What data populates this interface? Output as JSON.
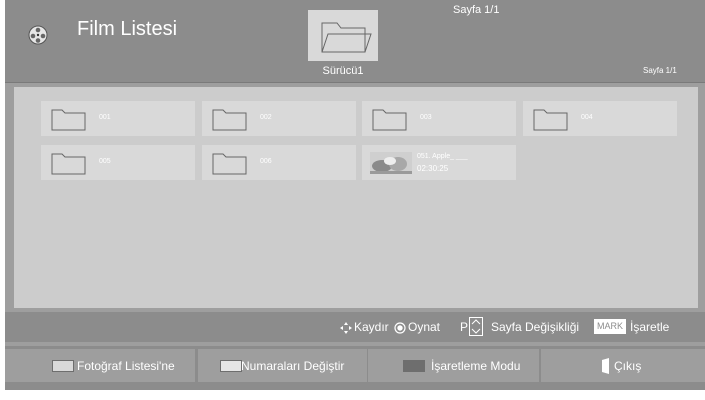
{
  "header": {
    "title": "Film Listesi",
    "drive_label": "Sürücü1",
    "page_top": "Sayfa 1/1",
    "page_right": "Sayfa 1/1"
  },
  "grid": {
    "folders": [
      {
        "label": "001"
      },
      {
        "label": "002"
      },
      {
        "label": "003"
      },
      {
        "label": "004"
      },
      {
        "label": "005"
      },
      {
        "label": "006"
      }
    ],
    "movie": {
      "title": "051. Apple_ ___",
      "duration": "02:30:25"
    }
  },
  "hints": {
    "scroll": "Kaydır",
    "play": "Oynat",
    "page_key": "P",
    "page_change": "Sayfa Değişikliği",
    "mark_key": "MARK",
    "mark": "İşaretle"
  },
  "footer": {
    "photo_list": "Fotoğraf Listesi'ne",
    "change_numbers": "Numaraları Değiştir",
    "mark_mode": "İşaretleme Modu",
    "exit": "Çıkış"
  },
  "colors": {
    "red_button": "#d9d9d9",
    "green_button": "#e6e6e6",
    "yellow_button": "#6e6e6e",
    "blue_button": "#ffffff"
  }
}
